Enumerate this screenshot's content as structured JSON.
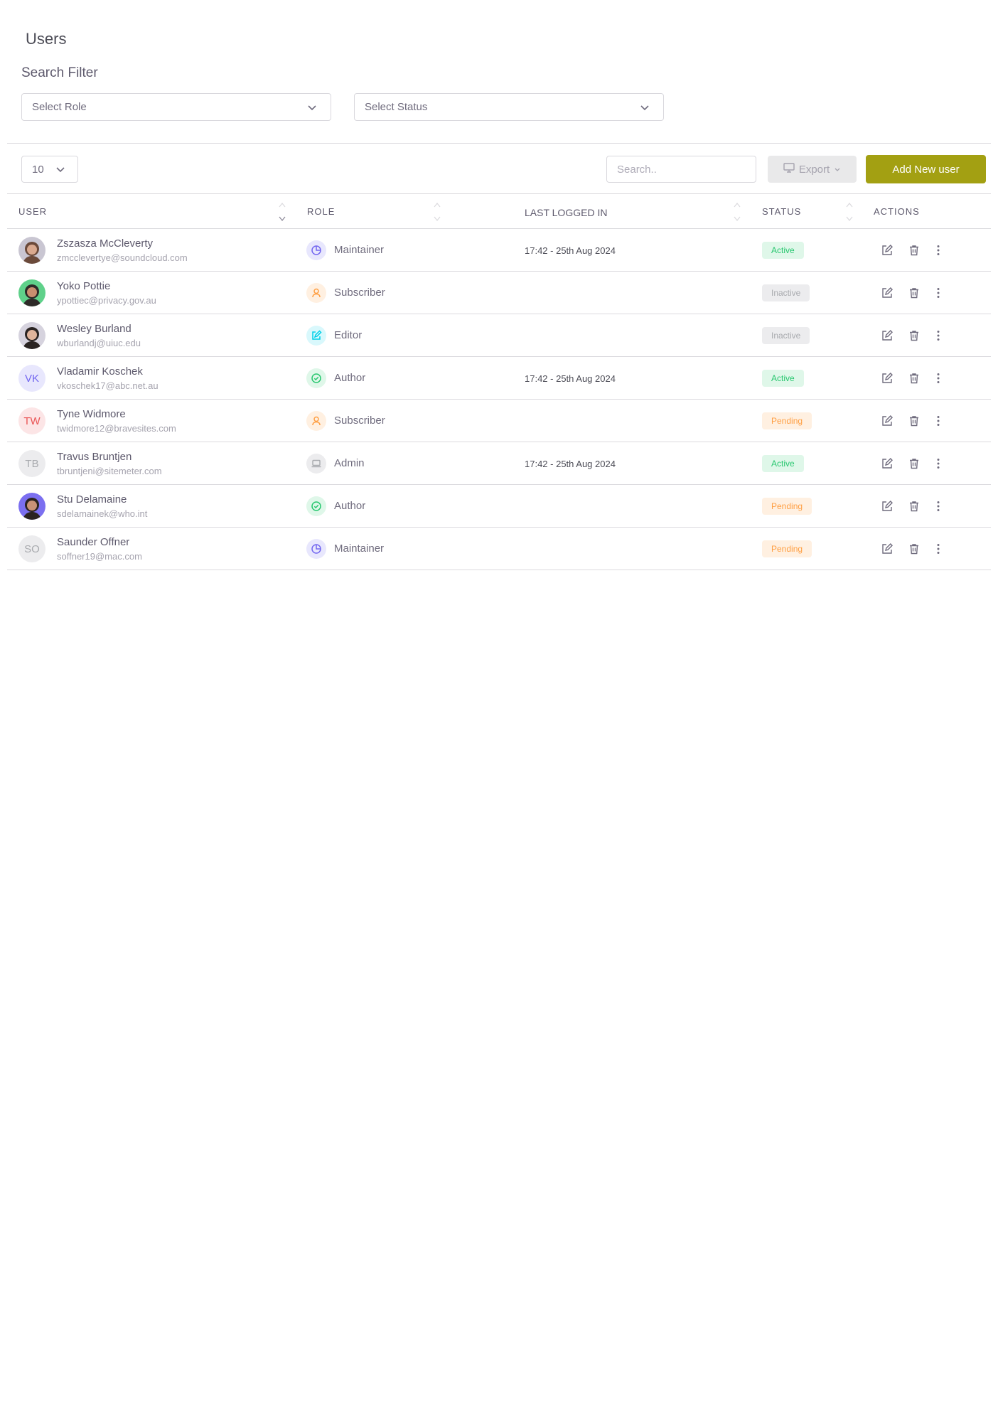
{
  "page": {
    "title": "Users",
    "filter_title": "Search Filter"
  },
  "filters": {
    "role_placeholder": "Select Role",
    "status_placeholder": "Select Status"
  },
  "toolbar": {
    "page_size": "10",
    "search_placeholder": "Search..",
    "export_label": "Export",
    "add_label": "Add New user"
  },
  "table": {
    "headers": [
      "USER",
      "ROLE",
      "LAST LOGGED IN",
      "STATUS",
      "ACTIONS"
    ],
    "rows": [
      {
        "name": "Zszasza McCleverty",
        "email": "zmcclevertye@soundcloud.com",
        "avatar": "photo",
        "initials": "",
        "role": "Maintainer",
        "role_icon": "pie-chart-icon",
        "last_login": "17:42 - 25th Aug 2024",
        "status": "Active"
      },
      {
        "name": "Yoko Pottie",
        "email": "ypottiec@privacy.gov.au",
        "avatar": "photo",
        "initials": "",
        "role": "Subscriber",
        "role_icon": "user-icon",
        "last_login": "",
        "status": "Inactive"
      },
      {
        "name": "Wesley Burland",
        "email": "wburlandj@uiuc.edu",
        "avatar": "photo",
        "initials": "",
        "role": "Editor",
        "role_icon": "edit-icon",
        "last_login": "",
        "status": "Inactive"
      },
      {
        "name": "Vladamir Koschek",
        "email": "vkoschek17@abc.net.au",
        "avatar": "initials",
        "initials": "VK",
        "role": "Author",
        "role_icon": "check-circle-icon",
        "last_login": "17:42 - 25th Aug 2024",
        "status": "Active"
      },
      {
        "name": "Tyne Widmore",
        "email": "twidmore12@bravesites.com",
        "avatar": "initials",
        "initials": "TW",
        "role": "Subscriber",
        "role_icon": "user-icon",
        "last_login": "",
        "status": "Pending"
      },
      {
        "name": "Travus Bruntjen",
        "email": "tbruntjeni@sitemeter.com",
        "avatar": "initials",
        "initials": "TB",
        "role": "Admin",
        "role_icon": "laptop-icon",
        "last_login": "17:42 - 25th Aug 2024",
        "status": "Active"
      },
      {
        "name": "Stu Delamaine",
        "email": "sdelamainek@who.int",
        "avatar": "photo",
        "initials": "",
        "role": "Author",
        "role_icon": "check-circle-icon",
        "last_login": "",
        "status": "Pending"
      },
      {
        "name": "Saunder Offner",
        "email": "soffner19@mac.com",
        "avatar": "initials",
        "initials": "SO",
        "role": "Maintainer",
        "role_icon": "pie-chart-icon",
        "last_login": "",
        "status": "Pending"
      }
    ]
  },
  "colors": {
    "primary_button": "#a3a012",
    "active": "#28c76f",
    "inactive": "#a8aaae",
    "pending": "#ff9f43",
    "maintainer": "#7367f0",
    "subscriber": "#ff9f43",
    "editor": "#00cfe8",
    "author": "#28c76f",
    "admin": "#a8aaae"
  }
}
